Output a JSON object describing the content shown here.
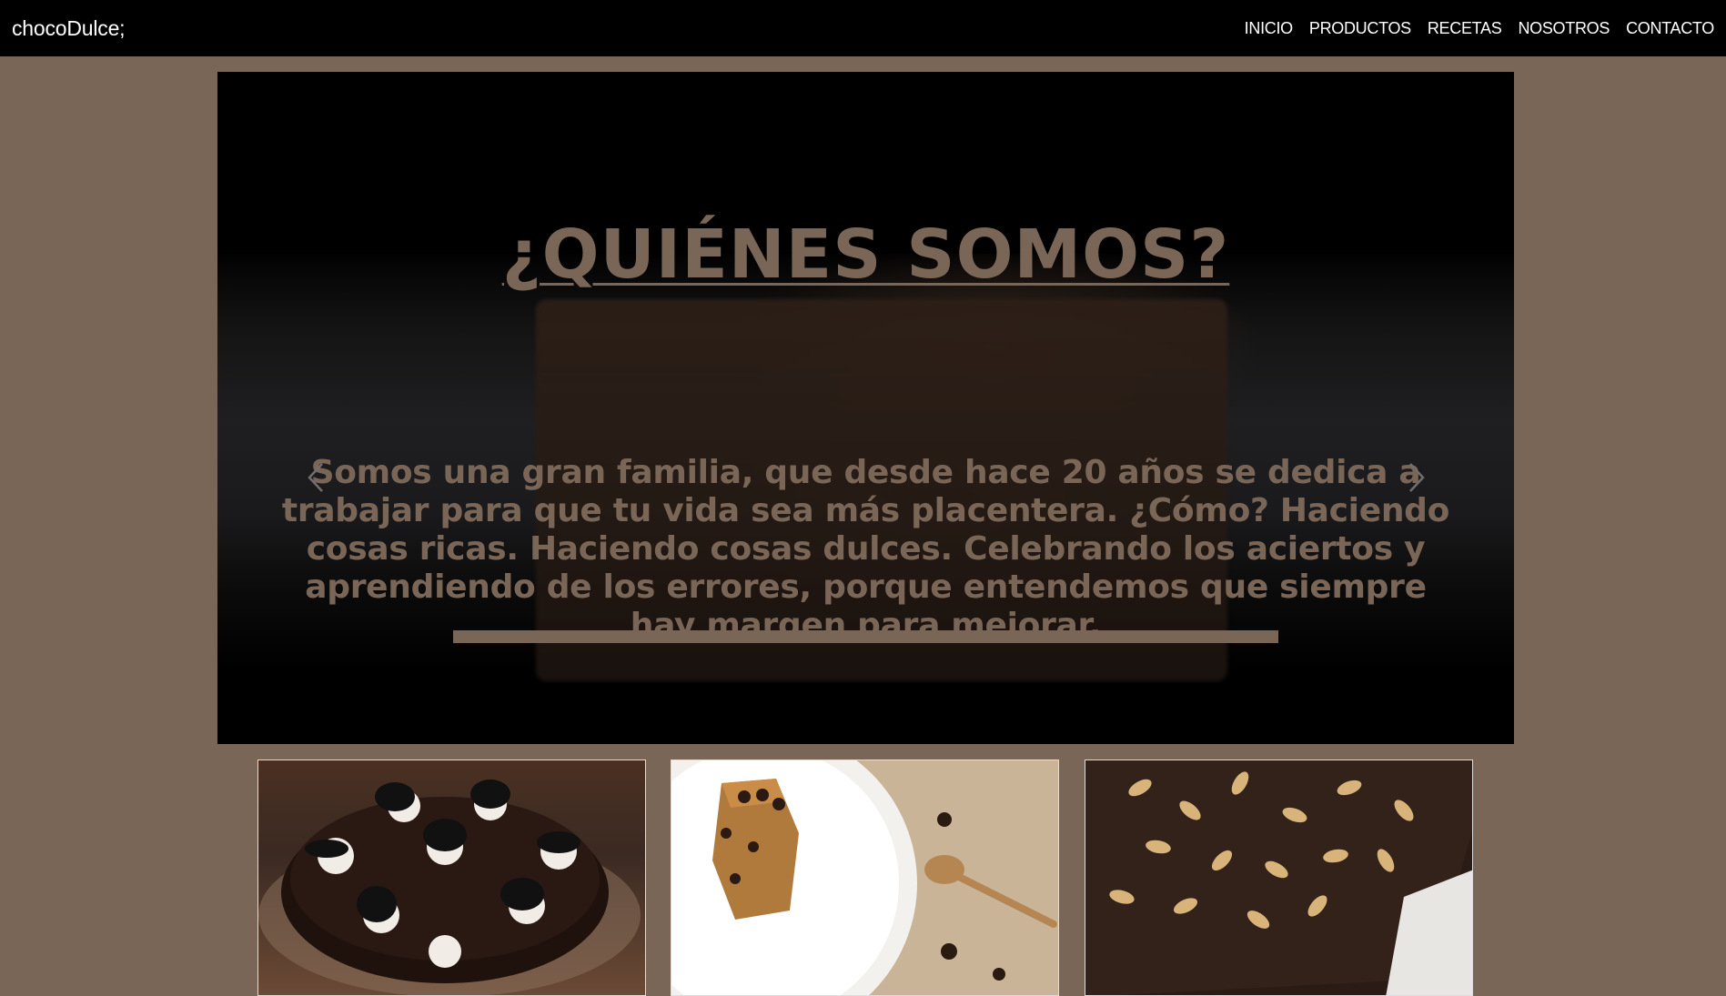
{
  "navbar": {
    "brand": "chocoDulce;",
    "links": [
      "INICIO",
      "PRODUCTOS",
      "RECETAS",
      "NOSOTROS",
      "CONTACTO"
    ]
  },
  "hero": {
    "title": "¿QUIÉNES SOMOS?",
    "text": "Somos una gran familia, que desde hace 20 años se dedica a trabajar para que tu vida sea más placentera. ¿Cómo? Haciendo cosas ricas. Haciendo cosas dulces. Celebrando los aciertos y aprendiendo de los errores, porque entendemos que siempre hay margen para mejorar.",
    "prev_icon": "chevron-left-icon",
    "next_icon": "chevron-right-icon"
  },
  "cards": [
    {
      "image": "chocolate-cake-with-oreos"
    },
    {
      "image": "cake-slice-on-plate"
    },
    {
      "image": "brownie-with-almonds"
    }
  ],
  "colors": {
    "background": "#7a6657",
    "navbar": "#000000",
    "accent": "#7a6657",
    "nav_text": "#ffffff"
  }
}
